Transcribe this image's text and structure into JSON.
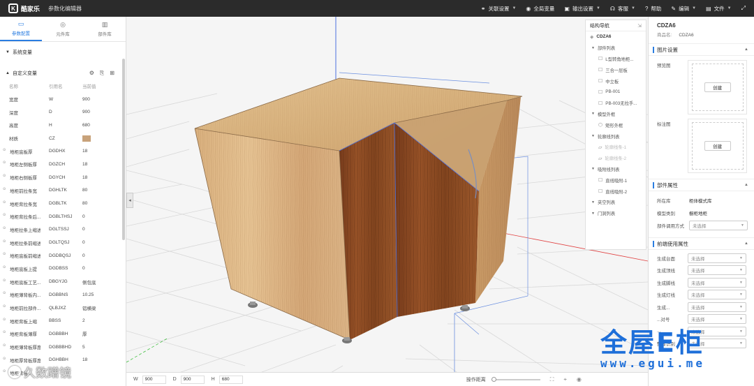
{
  "topbar": {
    "logo_text": "酷家乐",
    "app_title": "参数化编辑器",
    "menus": [
      {
        "label": "关联设置",
        "icon": "link-icon"
      },
      {
        "label": "全局变量",
        "icon": "globe-icon"
      },
      {
        "label": "输出设置",
        "icon": "output-icon"
      },
      {
        "label": "客服",
        "icon": "headset-icon"
      },
      {
        "label": "帮助",
        "icon": "help-icon"
      },
      {
        "label": "编辑",
        "icon": "edit-icon"
      },
      {
        "label": "文件",
        "icon": "file-icon"
      }
    ]
  },
  "left_panel": {
    "tabs": [
      {
        "label": "参数配置",
        "icon": "settings-icon",
        "active": true
      },
      {
        "label": "元件库",
        "icon": "component-icon",
        "active": false
      },
      {
        "label": "部件库",
        "icon": "parts-icon",
        "active": false
      }
    ],
    "system_vars_label": "系统变量",
    "custom_vars_label": "自定义变量",
    "columns": [
      "名称",
      "引用名",
      "当前值"
    ],
    "rows": [
      {
        "name": "宽度",
        "ref": "W",
        "value": "900",
        "dot": false
      },
      {
        "name": "深度",
        "ref": "D",
        "value": "900",
        "dot": false
      },
      {
        "name": "高度",
        "ref": "H",
        "value": "680",
        "dot": false
      },
      {
        "name": "材质",
        "ref": "CZ",
        "value": "",
        "dot": false,
        "swatch": "#c8a27a"
      },
      {
        "name": "地柜底板厚",
        "ref": "DGDHX",
        "value": "18",
        "dot": true
      },
      {
        "name": "地柜左侧板厚",
        "ref": "DGZCH",
        "value": "18",
        "dot": true
      },
      {
        "name": "地柜右侧板厚",
        "ref": "DGYCH",
        "value": "18",
        "dot": true
      },
      {
        "name": "地柜前拉条宽",
        "ref": "DGHLTK",
        "value": "80",
        "dot": true
      },
      {
        "name": "地柜背拉条宽",
        "ref": "DGBLTK",
        "value": "80",
        "dot": true
      },
      {
        "name": "地柜背拉条后...",
        "ref": "DGBLTHSJ",
        "value": "0",
        "dot": true
      },
      {
        "name": "地柜拉条上缩进",
        "ref": "DGLTSSJ",
        "value": "0",
        "dot": true
      },
      {
        "name": "地柜拉条前缩进",
        "ref": "DGLTQSJ",
        "value": "0",
        "dot": true
      },
      {
        "name": "地柜底板前缩进",
        "ref": "DGDBQSJ",
        "value": "0",
        "dot": true
      },
      {
        "name": "地柜底板上提",
        "ref": "DGDBSS",
        "value": "0",
        "dot": true
      },
      {
        "name": "地柜底板工艺...",
        "ref": "DBGYJG",
        "value": "侧包底",
        "dot": true
      },
      {
        "name": "地柜薄背板内...",
        "ref": "DGBBNS",
        "value": "10.25",
        "dot": true
      },
      {
        "name": "地柜前拉部件...",
        "ref": "QLBJXZ",
        "value": "铝横梁",
        "dot": true
      },
      {
        "name": "地柜背板上缩",
        "ref": "BBSS",
        "value": "2",
        "dot": true
      },
      {
        "name": "地柜背板薄厚",
        "ref": "DGBBBH",
        "value": "厚",
        "dot": true
      },
      {
        "name": "地柜薄背板厚度",
        "ref": "DGBBBHD",
        "value": "5",
        "dot": true
      },
      {
        "name": "地柜厚背板厚度",
        "ref": "DGHBBH",
        "value": "18",
        "dot": true
      },
      {
        "name": "地柜背板...",
        "ref": "",
        "value": "",
        "dot": true
      }
    ]
  },
  "structure_nav": {
    "title": "结构导航",
    "nodes": [
      {
        "level": 0,
        "label": "CDZA6",
        "icon": "layers-icon"
      },
      {
        "level": 1,
        "label": "部件列表",
        "tri": true
      },
      {
        "level": 2,
        "label": "L型转角地柜...",
        "icon": "box-icon"
      },
      {
        "level": 2,
        "label": "三合一层板",
        "icon": "box-icon"
      },
      {
        "level": 2,
        "label": "中立板",
        "icon": "box-icon"
      },
      {
        "level": 2,
        "label": "PB-001",
        "icon": "box-icon"
      },
      {
        "level": 2,
        "label": "PB-003无拉手...",
        "icon": "box-icon"
      },
      {
        "level": 1,
        "label": "模型外框",
        "tri": true
      },
      {
        "level": 2,
        "label": "矩形外框",
        "icon": "cube-icon"
      },
      {
        "level": 1,
        "label": "轮廓线列表",
        "tri": true
      },
      {
        "level": 2,
        "label": "轮廓线条-1",
        "icon": "outline-icon",
        "dim": true
      },
      {
        "level": 2,
        "label": "轮廓线条-2",
        "icon": "outline-icon",
        "dim": true
      },
      {
        "level": 1,
        "label": "吸附线列表",
        "tri": true
      },
      {
        "level": 2,
        "label": "直线吸附-1",
        "icon": "line-icon"
      },
      {
        "level": 2,
        "label": "直线吸附-2",
        "icon": "line-icon"
      },
      {
        "level": 1,
        "label": "夹空列表",
        "tri": true
      },
      {
        "level": 1,
        "label": "门洞列表",
        "tri": true
      }
    ]
  },
  "right_panel": {
    "title": "CDZA6",
    "product_label": "商品名:",
    "product_value": "CDZA6",
    "image_section": "图片设置",
    "preview_label": "预览图",
    "annotate_label": "标注图",
    "create_label": "创建",
    "parts_section": "部件属性",
    "props": [
      {
        "label": "所在库",
        "value": "柜体模式库"
      },
      {
        "label": "模型类别",
        "value": "橱柜地柜"
      }
    ],
    "reference_label": "部件调用方式",
    "reference_value": "未选择",
    "frontend_section": "前端使用属性",
    "frontend_fields": [
      {
        "label": "生成台面",
        "value": "未选择"
      },
      {
        "label": "生成顶线",
        "value": "未选择"
      },
      {
        "label": "生成脚线",
        "value": "未选择"
      },
      {
        "label": "生成灯线",
        "value": "未选择"
      },
      {
        "label": "生成...",
        "value": "未选择"
      },
      {
        "label": "...对号",
        "value": "未选择"
      },
      {
        "label": "...",
        "value": "未选择"
      },
      {
        "label": "整体识别",
        "value": "未选择"
      }
    ]
  },
  "bottom_bar": {
    "w_label": "W",
    "w_value": "900",
    "d_label": "D",
    "d_value": "900",
    "h_label": "H",
    "h_value": "680",
    "distance_label": "操作距离"
  },
  "watermarks": {
    "brand": "全屋E柜",
    "url": "www.egui.me",
    "user": "久数蹭镜"
  }
}
